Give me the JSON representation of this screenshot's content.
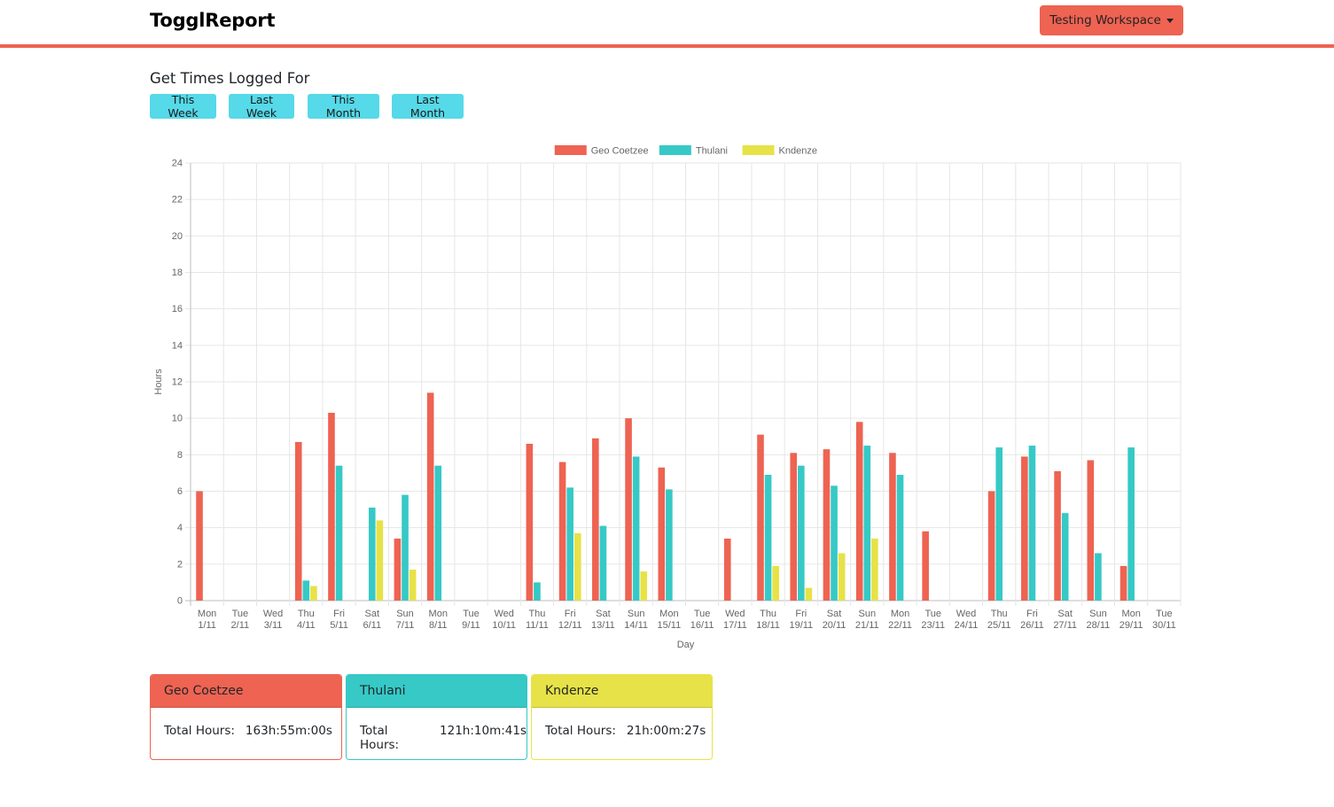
{
  "app": {
    "brand": "TogglReport",
    "workspace_label": "Testing Workspace"
  },
  "period": {
    "title": "Get Times Logged For",
    "buttons": [
      "This Week",
      "Last Week",
      "This Month",
      "Last Month"
    ]
  },
  "colors": {
    "accent": "#ee6352",
    "period_button": "#56d9e8",
    "series": [
      "#ee6352",
      "#36c9c6",
      "#e7e247"
    ]
  },
  "chart_data": {
    "type": "bar",
    "xlabel": "Day",
    "ylabel": "Hours",
    "ylim": [
      0,
      24
    ],
    "ytick_step": 2,
    "grid": true,
    "legend": "top-center",
    "categories": [
      [
        "Mon",
        "1/11"
      ],
      [
        "Tue",
        "2/11"
      ],
      [
        "Wed",
        "3/11"
      ],
      [
        "Thu",
        "4/11"
      ],
      [
        "Fri",
        "5/11"
      ],
      [
        "Sat",
        "6/11"
      ],
      [
        "Sun",
        "7/11"
      ],
      [
        "Mon",
        "8/11"
      ],
      [
        "Tue",
        "9/11"
      ],
      [
        "Wed",
        "10/11"
      ],
      [
        "Thu",
        "11/11"
      ],
      [
        "Fri",
        "12/11"
      ],
      [
        "Sat",
        "13/11"
      ],
      [
        "Sun",
        "14/11"
      ],
      [
        "Mon",
        "15/11"
      ],
      [
        "Tue",
        "16/11"
      ],
      [
        "Wed",
        "17/11"
      ],
      [
        "Thu",
        "18/11"
      ],
      [
        "Fri",
        "19/11"
      ],
      [
        "Sat",
        "20/11"
      ],
      [
        "Sun",
        "21/11"
      ],
      [
        "Mon",
        "22/11"
      ],
      [
        "Tue",
        "23/11"
      ],
      [
        "Wed",
        "24/11"
      ],
      [
        "Thu",
        "25/11"
      ],
      [
        "Fri",
        "26/11"
      ],
      [
        "Sat",
        "27/11"
      ],
      [
        "Sun",
        "28/11"
      ],
      [
        "Mon",
        "29/11"
      ],
      [
        "Tue",
        "30/11"
      ]
    ],
    "series": [
      {
        "name": "Geo Coetzee",
        "values": [
          6.0,
          0,
          0,
          8.7,
          10.3,
          0,
          3.4,
          11.4,
          0,
          0,
          8.6,
          7.6,
          8.9,
          10.0,
          7.3,
          0,
          3.4,
          9.1,
          8.1,
          8.3,
          9.8,
          8.1,
          3.8,
          0,
          6.0,
          7.9,
          7.1,
          7.7,
          1.9,
          0
        ]
      },
      {
        "name": "Thulani",
        "values": [
          0,
          0,
          0,
          1.1,
          7.4,
          5.1,
          5.8,
          7.4,
          0,
          0,
          1.0,
          6.2,
          4.1,
          7.9,
          6.1,
          0,
          0,
          6.9,
          7.4,
          6.3,
          8.5,
          6.9,
          0,
          0,
          8.4,
          8.5,
          4.8,
          2.6,
          8.4,
          0
        ]
      },
      {
        "name": "Kndenze",
        "values": [
          0,
          0,
          0,
          0.8,
          0,
          4.4,
          1.7,
          0,
          0,
          0,
          0,
          3.7,
          0,
          1.6,
          0,
          0,
          0,
          1.9,
          0.7,
          2.6,
          3.4,
          0,
          0,
          0,
          0,
          0,
          0,
          0,
          0,
          0
        ]
      }
    ]
  },
  "summary": {
    "total_label": "Total Hours:",
    "cards": [
      {
        "name": "Geo Coetzee",
        "total": "163h:55m:00s"
      },
      {
        "name": "Thulani",
        "total": "121h:10m:41s"
      },
      {
        "name": "Kndenze",
        "total": "21h:00m:27s"
      }
    ]
  }
}
